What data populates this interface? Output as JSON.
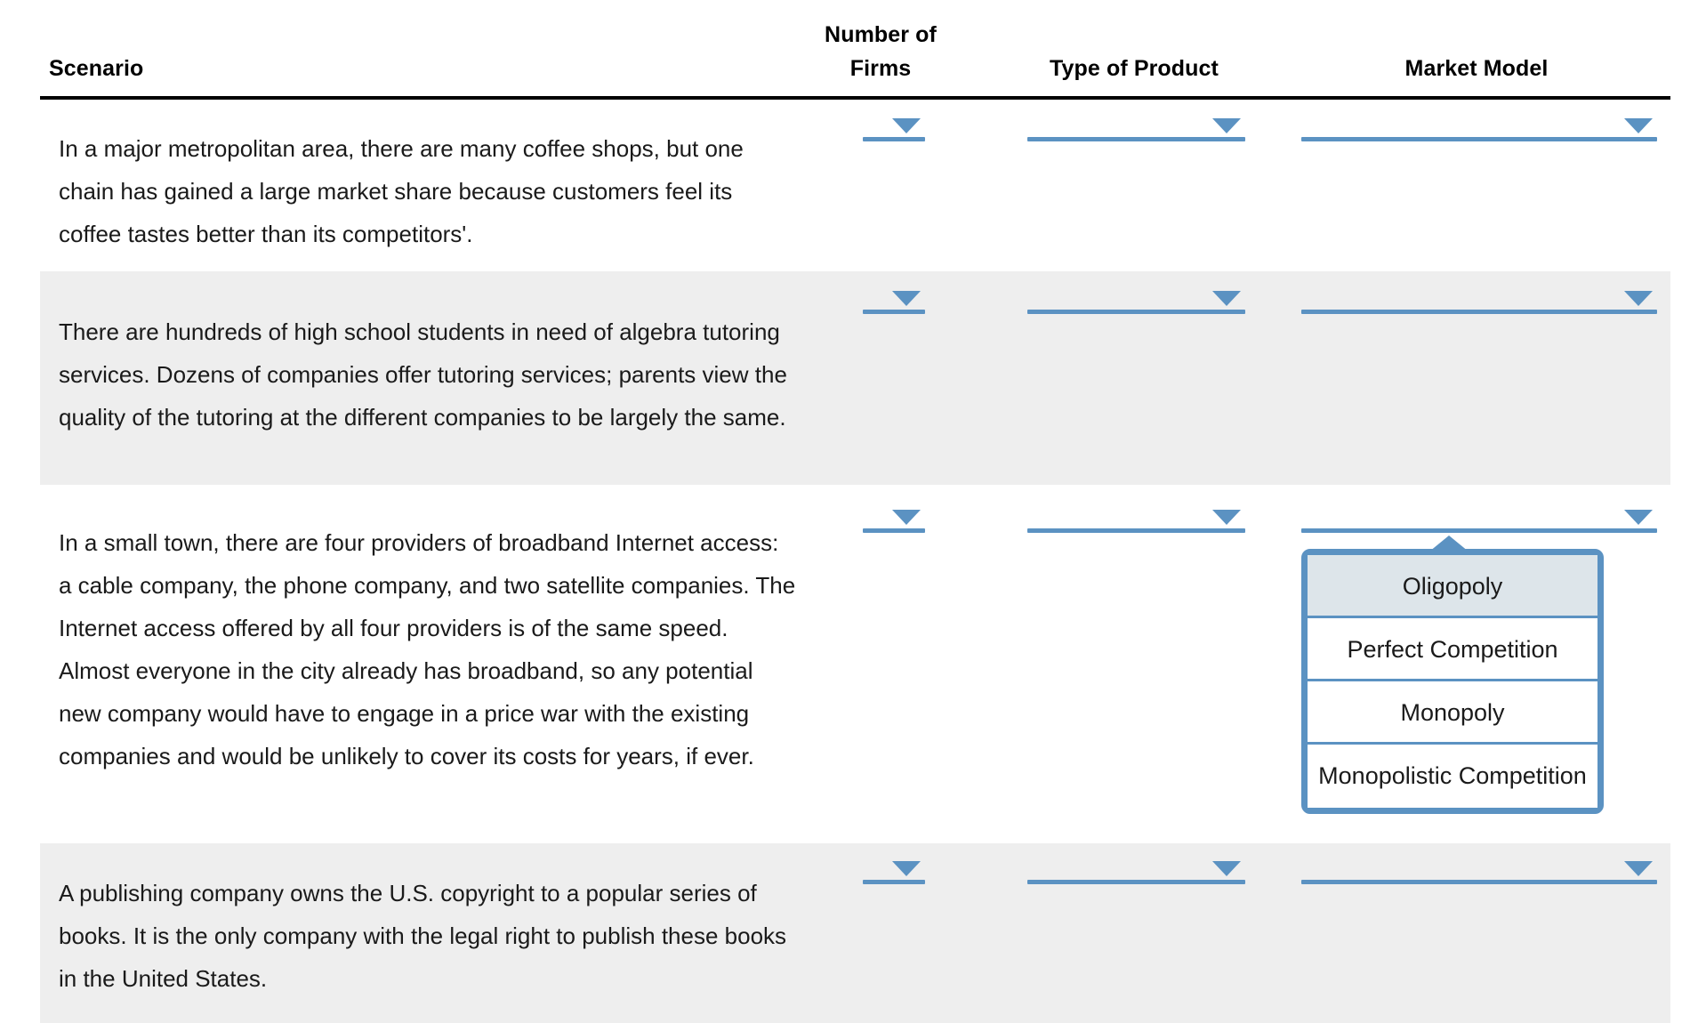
{
  "table": {
    "headers": {
      "scenario": "Scenario",
      "number_of": "Number of",
      "firms": "Firms",
      "type_of_product": "Type of Product",
      "market_model": "Market Model"
    },
    "rows": [
      {
        "scenario": "In a major metropolitan area, there are many coffee shops, but one chain has gained a large market share because customers feel its coffee tastes better than its competitors'.",
        "number_of_firms": "",
        "type_of_product": "",
        "market_model": ""
      },
      {
        "scenario": "There are hundreds of high school students in need of algebra tutoring services. Dozens of companies offer tutoring services; parents view the quality of the tutoring at the different companies to be largely the same.",
        "number_of_firms": "",
        "type_of_product": "",
        "market_model": ""
      },
      {
        "scenario": "In a small town, there are four providers of broadband Internet access: a cable company, the phone company, and two satellite companies. The Internet access offered by all four providers is of the same speed. Almost everyone in the city already has broadband, so any potential new company would have to engage in a price war with the existing companies and would be unlikely to cover its costs for years, if ever.",
        "number_of_firms": "",
        "type_of_product": "",
        "market_model": ""
      },
      {
        "scenario": "A publishing company owns the U.S. copyright to a popular series of books. It is the only company with the legal right to publish these books in the United States.",
        "number_of_firms": "",
        "type_of_product": "",
        "market_model": ""
      }
    ]
  },
  "open_dropdown": {
    "belongs_to_row": 3,
    "column": "Market Model",
    "selected": "Oligopoly",
    "options": [
      "Oligopoly",
      "Perfect Competition",
      "Monopoly",
      "Monopolistic Competition"
    ]
  },
  "icons": {
    "caret_down": "chevron-down-icon",
    "caret_up": "chevron-up-icon"
  },
  "colors": {
    "accent": "#5b92c2",
    "row_shade": "#eeeeee",
    "selected_option_bg": "#dde5ea",
    "rule": "#000000",
    "text": "#1a1a1a"
  }
}
